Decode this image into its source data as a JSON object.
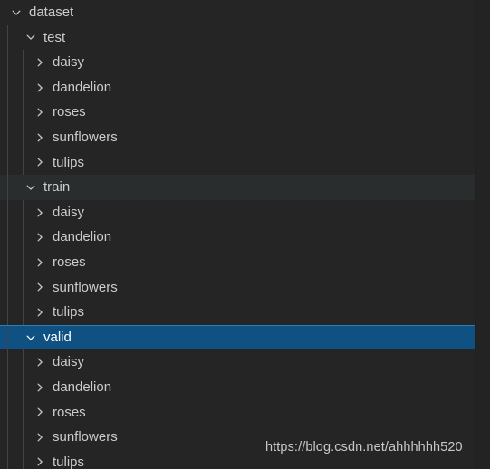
{
  "explorer": {
    "title": "dataset file tree",
    "colors": {
      "background": "#252526",
      "text": "#cccccc",
      "selected_background": "#0e5182",
      "selected_border": "#2a7fb8",
      "hover_background": "#2a2d2e",
      "indent_guide": "#424345"
    },
    "icons": {
      "expanded": "chevron-down-icon",
      "collapsed": "chevron-right-icon"
    },
    "rows": [
      {
        "label": "dataset",
        "level": 0,
        "state": "expanded",
        "icon": "chevron-down-icon",
        "selected": false,
        "hover": false
      },
      {
        "label": "test",
        "level": 1,
        "state": "expanded",
        "icon": "chevron-down-icon",
        "selected": false,
        "hover": false
      },
      {
        "label": "daisy",
        "level": 2,
        "state": "collapsed",
        "icon": "chevron-right-icon",
        "selected": false,
        "hover": false
      },
      {
        "label": "dandelion",
        "level": 2,
        "state": "collapsed",
        "icon": "chevron-right-icon",
        "selected": false,
        "hover": false
      },
      {
        "label": "roses",
        "level": 2,
        "state": "collapsed",
        "icon": "chevron-right-icon",
        "selected": false,
        "hover": false
      },
      {
        "label": "sunflowers",
        "level": 2,
        "state": "collapsed",
        "icon": "chevron-right-icon",
        "selected": false,
        "hover": false
      },
      {
        "label": "tulips",
        "level": 2,
        "state": "collapsed",
        "icon": "chevron-right-icon",
        "selected": false,
        "hover": false
      },
      {
        "label": "train",
        "level": 1,
        "state": "expanded",
        "icon": "chevron-down-icon",
        "selected": false,
        "hover": true
      },
      {
        "label": "daisy",
        "level": 2,
        "state": "collapsed",
        "icon": "chevron-right-icon",
        "selected": false,
        "hover": false
      },
      {
        "label": "dandelion",
        "level": 2,
        "state": "collapsed",
        "icon": "chevron-right-icon",
        "selected": false,
        "hover": false
      },
      {
        "label": "roses",
        "level": 2,
        "state": "collapsed",
        "icon": "chevron-right-icon",
        "selected": false,
        "hover": false
      },
      {
        "label": "sunflowers",
        "level": 2,
        "state": "collapsed",
        "icon": "chevron-right-icon",
        "selected": false,
        "hover": false
      },
      {
        "label": "tulips",
        "level": 2,
        "state": "collapsed",
        "icon": "chevron-right-icon",
        "selected": false,
        "hover": false
      },
      {
        "label": "valid",
        "level": 1,
        "state": "expanded",
        "icon": "chevron-down-icon",
        "selected": true,
        "hover": false
      },
      {
        "label": "daisy",
        "level": 2,
        "state": "collapsed",
        "icon": "chevron-right-icon",
        "selected": false,
        "hover": false
      },
      {
        "label": "dandelion",
        "level": 2,
        "state": "collapsed",
        "icon": "chevron-right-icon",
        "selected": false,
        "hover": false
      },
      {
        "label": "roses",
        "level": 2,
        "state": "collapsed",
        "icon": "chevron-right-icon",
        "selected": false,
        "hover": false
      },
      {
        "label": "sunflowers",
        "level": 2,
        "state": "collapsed",
        "icon": "chevron-right-icon",
        "selected": false,
        "hover": false
      },
      {
        "label": "tulips",
        "level": 2,
        "state": "collapsed",
        "icon": "chevron-right-icon",
        "selected": false,
        "hover": false
      }
    ]
  },
  "watermark": {
    "text": "https://blog.csdn.net/ahhhhhh520"
  }
}
